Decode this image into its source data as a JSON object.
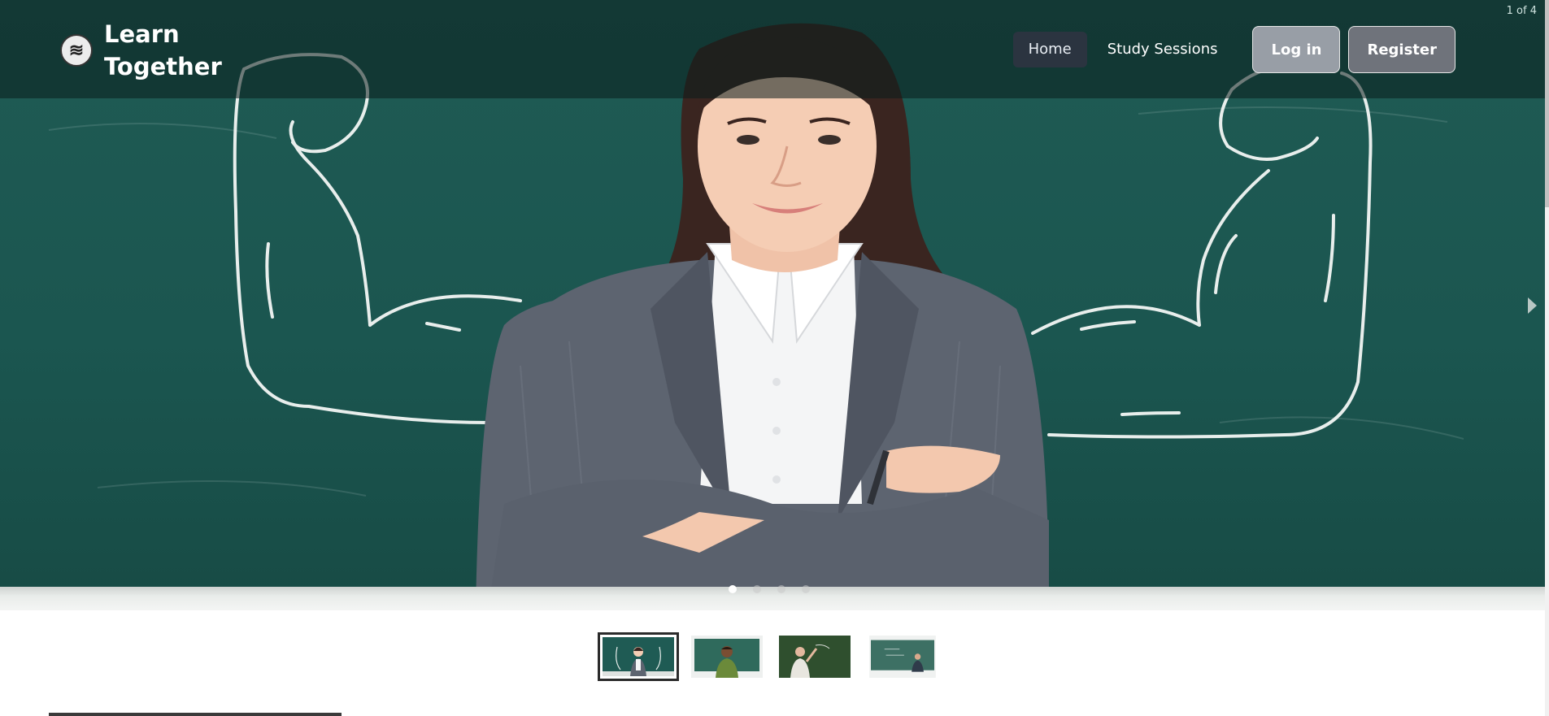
{
  "brand": {
    "name": "Learn Together",
    "logo_icon": "book-stack-icon"
  },
  "nav": {
    "links": [
      {
        "label": "Home",
        "active": true
      },
      {
        "label": "Study Sessions",
        "active": false
      }
    ],
    "login_label": "Log in",
    "register_label": "Register"
  },
  "carousel": {
    "counter": "1 of 4",
    "total_slides": 4,
    "active_index": 0,
    "next_icon": "chevron-right-icon"
  },
  "colors": {
    "chalkboard": "#1f5b54",
    "nav_active_bg": "#2b3440",
    "login_bg": "#989ea6",
    "register_bg": "#6f737b"
  }
}
